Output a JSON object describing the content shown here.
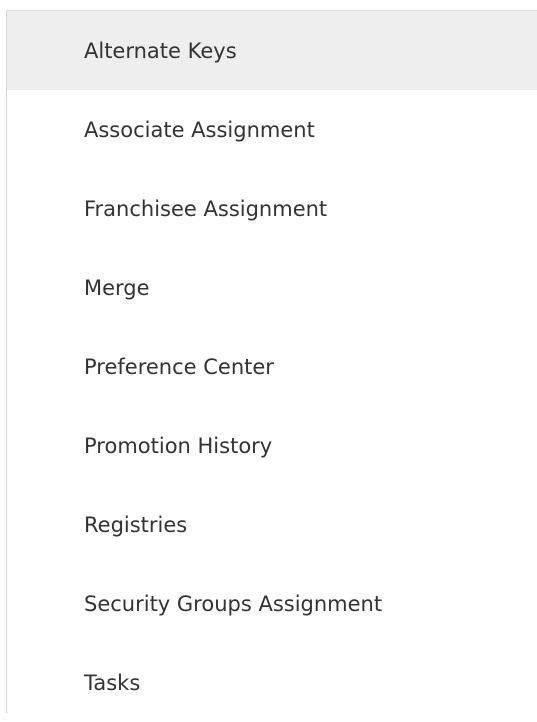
{
  "menu": {
    "items": [
      {
        "label": "Alternate Keys",
        "active": true
      },
      {
        "label": "Associate Assignment",
        "active": false
      },
      {
        "label": "Franchisee Assignment",
        "active": false
      },
      {
        "label": "Merge",
        "active": false
      },
      {
        "label": "Preference Center",
        "active": false
      },
      {
        "label": "Promotion History",
        "active": false
      },
      {
        "label": "Registries",
        "active": false
      },
      {
        "label": "Security Groups Assignment",
        "active": false
      },
      {
        "label": "Tasks",
        "active": false
      }
    ]
  }
}
